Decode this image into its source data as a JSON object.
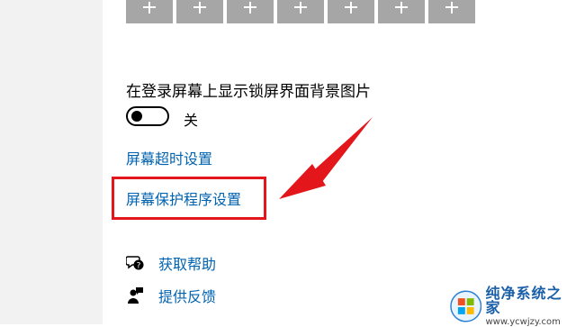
{
  "lock_screen": {
    "show_background_label": "在登录屏幕上显示锁屏界面背景图片",
    "toggle_state": "off",
    "toggle_state_label": "关"
  },
  "links": {
    "screen_timeout": "屏幕超时设置",
    "screen_saver": "屏幕保护程序设置"
  },
  "help": {
    "get_help": "获取帮助",
    "give_feedback": "提供反馈"
  },
  "watermark": {
    "title": "纯净系统之家",
    "url": "www.ycwjzy.com"
  },
  "colors": {
    "link": "#0063b1",
    "annotation_red": "#e3171b",
    "tile_gray": "#a6a6a6"
  }
}
